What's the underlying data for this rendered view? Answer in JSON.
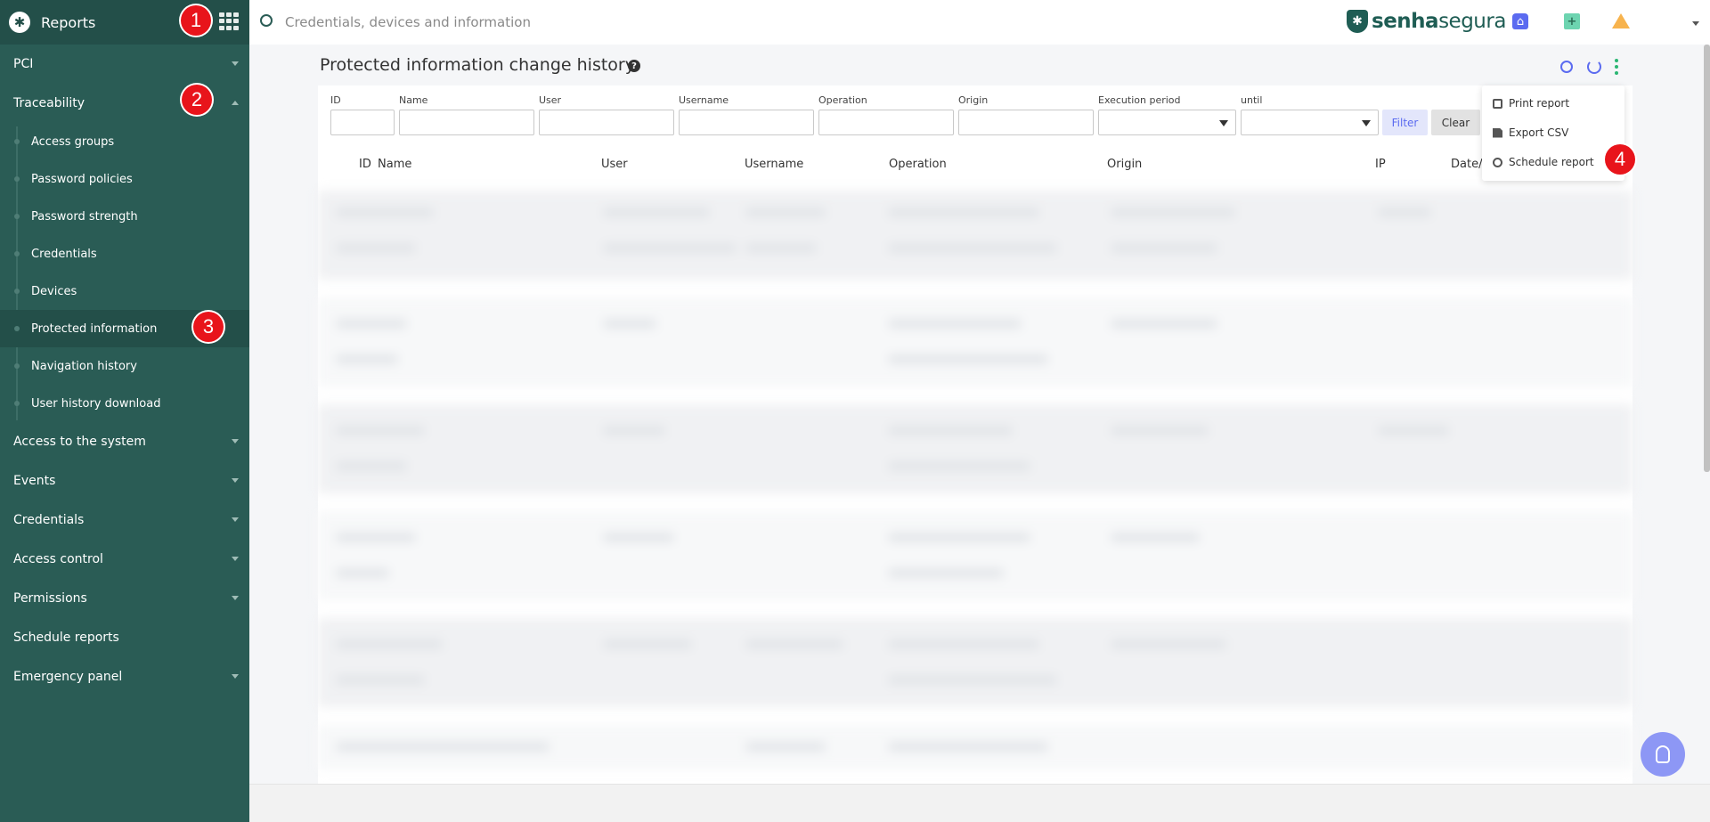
{
  "sidebar": {
    "title": "Reports",
    "sections": [
      {
        "label": "PCI",
        "expanded": false
      },
      {
        "label": "Traceability",
        "expanded": true
      },
      {
        "label": "Access to the system",
        "expanded": false
      },
      {
        "label": "Events",
        "expanded": false
      },
      {
        "label": "Credentials",
        "expanded": false
      },
      {
        "label": "Access control",
        "expanded": false
      },
      {
        "label": "Permissions",
        "expanded": false
      },
      {
        "label": "Schedule reports",
        "expanded": false
      },
      {
        "label": "Emergency panel",
        "expanded": false
      }
    ],
    "traceability_items": [
      "Access groups",
      "Password policies",
      "Password strength",
      "Credentials",
      "Devices",
      "Protected information",
      "Navigation history",
      "User history download"
    ],
    "active_item": "Protected information"
  },
  "topbar": {
    "search_placeholder": "Credentials, devices and information",
    "brand_bold": "senha",
    "brand_light": "segura"
  },
  "page": {
    "title": "Protected information change history"
  },
  "filters": {
    "id_label": "ID",
    "name_label": "Name",
    "user_label": "User",
    "username_label": "Username",
    "operation_label": "Operation",
    "origin_label": "Origin",
    "execution_period_label": "Execution period",
    "until_label": "until",
    "filter_button": "Filter",
    "clear_button": "Clear"
  },
  "table": {
    "columns": [
      "ID",
      "Name",
      "User",
      "Username",
      "Operation",
      "Origin",
      "IP",
      "Date/"
    ]
  },
  "dropdown": {
    "print": "Print report",
    "export": "Export CSV",
    "schedule": "Schedule report"
  },
  "annotations": [
    "1",
    "2",
    "3",
    "4"
  ],
  "colors": {
    "sidebar": "#2a5c55",
    "accent": "#5b6bf0",
    "badge": "#e8141b"
  }
}
